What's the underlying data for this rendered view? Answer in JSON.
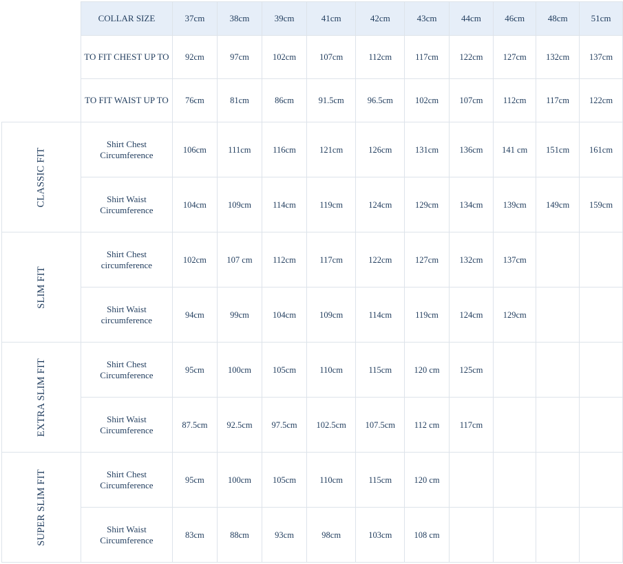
{
  "header": {
    "first_label": "COLLAR SIZE",
    "sizes": [
      "37cm",
      "38cm",
      "39cm",
      "41cm",
      "42cm",
      "43cm",
      "44cm",
      "46cm",
      "48cm",
      "51cm"
    ]
  },
  "top_rows": [
    {
      "label": "TO FIT CHEST UP TO",
      "values": [
        "92cm",
        "97cm",
        "102cm",
        "107cm",
        "112cm",
        "117cm",
        "122cm",
        "127cm",
        "132cm",
        "137cm"
      ]
    },
    {
      "label": "TO FIT WAIST UP TO",
      "values": [
        "76cm",
        "81cm",
        "86cm",
        "91.5cm",
        "96.5cm",
        "102cm",
        "107cm",
        "112cm",
        "117cm",
        "122cm"
      ]
    }
  ],
  "fits": [
    {
      "name": "CLASSIC FIT",
      "rows": [
        {
          "label": "Shirt Chest Circumference",
          "values": [
            "106cm",
            "111cm",
            "116cm",
            "121cm",
            "126cm",
            "131cm",
            "136cm",
            "141 cm",
            "151cm",
            "161cm"
          ]
        },
        {
          "label": "Shirt Waist Circumference",
          "values": [
            "104cm",
            "109cm",
            "114cm",
            "119cm",
            "124cm",
            "129cm",
            "134cm",
            "139cm",
            "149cm",
            "159cm"
          ]
        }
      ]
    },
    {
      "name": "SLIM FIT",
      "rows": [
        {
          "label": "Shirt Chest circumference",
          "values": [
            "102cm",
            "107 cm",
            "112cm",
            "117cm",
            "122cm",
            "127cm",
            "132cm",
            "137cm",
            "",
            ""
          ]
        },
        {
          "label": "Shirt Waist circumference",
          "values": [
            "94cm",
            "99cm",
            "104cm",
            "109cm",
            "114cm",
            "119cm",
            "124cm",
            "129cm",
            "",
            ""
          ]
        }
      ]
    },
    {
      "name": "EXTRA SLIM FIT",
      "rows": [
        {
          "label": "Shirt Chest Circumference",
          "values": [
            "95cm",
            "100cm",
            "105cm",
            "110cm",
            "115cm",
            "120 cm",
            "125cm",
            "",
            "",
            ""
          ]
        },
        {
          "label": "Shirt Waist Circumference",
          "values": [
            "87.5cm",
            "92.5cm",
            "97.5cm",
            "102.5cm",
            "107.5cm",
            "112 cm",
            "117cm",
            "",
            "",
            ""
          ]
        }
      ]
    },
    {
      "name": "SUPER SLIM FIT",
      "rows": [
        {
          "label": "Shirt Chest Circumference",
          "values": [
            "95cm",
            "100cm",
            "105cm",
            "110cm",
            "115cm",
            "120 cm",
            "",
            "",
            "",
            ""
          ]
        },
        {
          "label": "Shirt Waist Circumference",
          "values": [
            "83cm",
            "88cm",
            "93cm",
            "98cm",
            "103cm",
            "108 cm",
            "",
            "",
            "",
            ""
          ]
        }
      ]
    }
  ],
  "colors": {
    "text": "#1f3b5c",
    "header_bg": "#e6eef8",
    "border": "#dde3ea"
  }
}
